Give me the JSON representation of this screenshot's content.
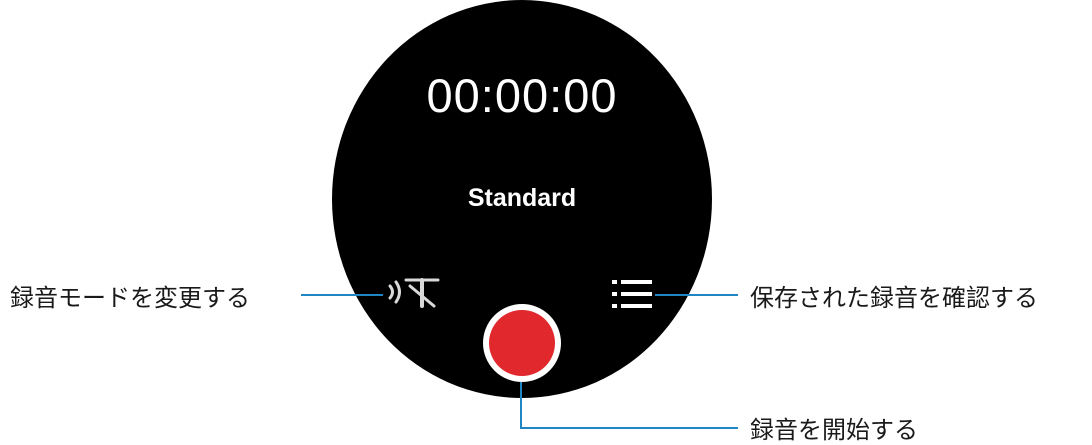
{
  "watch": {
    "timer": "00:00:00",
    "mode": "Standard",
    "icons": {
      "mode": "recording-mode-icon",
      "list": "list-icon",
      "record": "record-icon"
    }
  },
  "callouts": {
    "change_mode": "録音モードを変更する",
    "view_saved": "保存された録音を確認する",
    "start_recording": "録音を開始する"
  },
  "colors": {
    "accent_line": "#1f86c3",
    "record_red": "#e0282d"
  }
}
